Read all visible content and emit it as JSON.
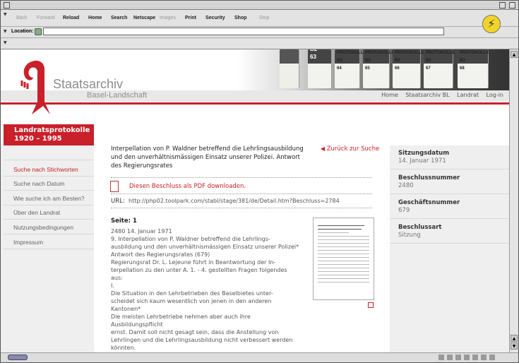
{
  "toolbar": {
    "back": "Back",
    "forward": "Forward",
    "reload": "Reload",
    "home": "Home",
    "search": "Search",
    "netscape": "Netscape",
    "images": "Images",
    "print": "Print",
    "security": "Security",
    "shop": "Shop",
    "stop": "Stop"
  },
  "location": {
    "label": "Location:",
    "value": ""
  },
  "site": {
    "title1": "Staatsarchiv",
    "title2": "Basel-Landschaft"
  },
  "books": [
    {
      "label": "B2\n63"
    },
    {
      "label": "PROTOKOLLE\nB2\n64"
    },
    {
      "label": "PROTOKOLLE\nB2\n65"
    },
    {
      "label": "PROTOKOLLE\nB2\n66"
    },
    {
      "label": "PROTOKOLLE\nB2\n67"
    },
    {
      "label": "PROTOKOLLE\nB2\n68"
    }
  ],
  "topnav": [
    "Home",
    "Staatsarchiv BL",
    "Landrat",
    "Log-in"
  ],
  "sidebar": {
    "heading": "Landratsprotokolle\n1920 – 1995",
    "items": [
      {
        "label": "Suche nach Stichworten"
      },
      {
        "label": "Suche nach Datum"
      },
      {
        "label": "Wie suche ich am Besten?"
      },
      {
        "label": "Über den Landrat"
      },
      {
        "label": "Nutzungsbedingungen"
      },
      {
        "label": "Impressum"
      }
    ]
  },
  "main": {
    "title": "Interpellation von P. Waldner betreffend die Lehrlingsausbildung und den unverhältnismässigen Einsatz unserer Polizei. Antwort des Regierungsrates",
    "back_link": "Zurück zur Suche",
    "pdf_link": "Diesen Beschluss als PDF downloaden.",
    "url_label": "URL:",
    "url_value": "http://php02.toolpark.com/stabl/stage/381/de/Detail.htm?Beschluss=2784",
    "page_label": "Seite: 1",
    "body": "2480 14. Januar 1971\n9. Interpellation von P. Waldner betreffend die Lehrlings-\nausbildung und den unverhältnismässigen Einsatz unserer Polizei*\nAntwort des Regierungsrates (679)\nRegierungsrat Dr. L. Lejeune führt in Beantwortung der In-\nterpellation zu den unter A. 1. - 4. gestellten Fragen folgendes\naus:\nI.\nDie Situation in den Lehrbetrieben des Baselbietes unter-\nscheidet sich kaum wesentlich von jenen in den anderen Kantonen*\nDie meisten Lehrbetriebe nehmen aber auch ihre\nAusbildungspflicht\nernst. Damit soll nicht gesagt sein, dass die Anstellung von\nLehrlingen und die Lehrlingsausbildung nicht verbessert werden\nkönnten.\nZur uage im Radioelektrikergewerbe im speziellen ist zu ver-\nmerken, dass es sich hier um eine Branche handelt, die ihre Lehr-"
  },
  "meta": {
    "items": [
      {
        "label": "Sitzungsdatum",
        "value": "14. Januar 1971"
      },
      {
        "label": "Beschlussnummer",
        "value": "2480"
      },
      {
        "label": "Geschäftsnummer",
        "value": "679"
      },
      {
        "label": "Beschlussart",
        "value": "Sitzung"
      }
    ]
  },
  "colors": {
    "accent": "#c9202a"
  }
}
